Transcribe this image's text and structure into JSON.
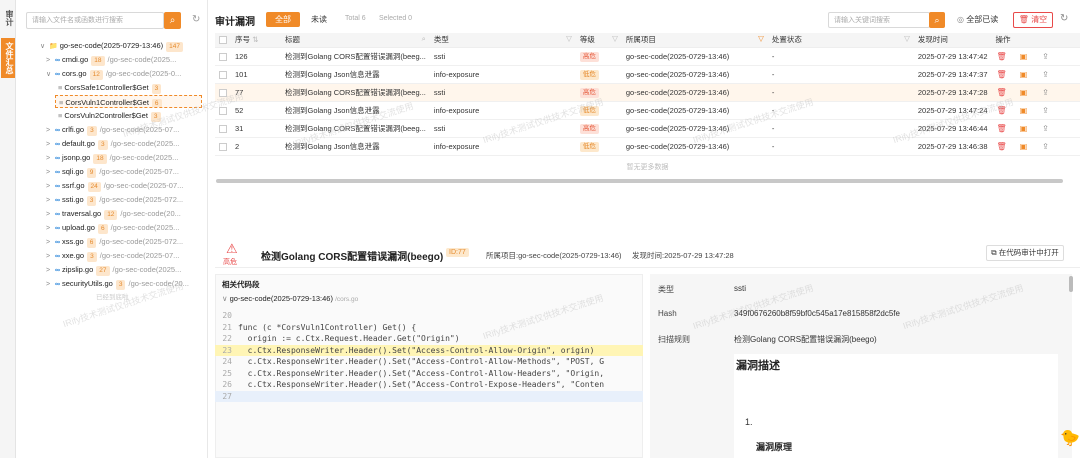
{
  "sidebar_tabs": {
    "tab1": "审计",
    "tab2": "文件汇总"
  },
  "left": {
    "search_placeholder": "请输入文件名或函数进行搜索",
    "tree": [
      {
        "label": "go-sec-code(2025-0729-13:46)",
        "badge": "147",
        "path": ""
      },
      {
        "label": "cmdi.go",
        "badge": "18",
        "path": "/go-sec-code(2025..."
      },
      {
        "label": "cors.go",
        "badge": "12",
        "path": "/go-sec-code(2025-0..."
      },
      {
        "label": "CorsSafe1Controller$Get",
        "badge": "3",
        "path": ""
      },
      {
        "label": "CorsVuln1Controller$Get",
        "badge": "6",
        "path": ""
      },
      {
        "label": "CorsVuln2Controller$Get",
        "badge": "3",
        "path": ""
      },
      {
        "label": "crlfi.go",
        "badge": "3",
        "path": "/go-sec-code(2025-07..."
      },
      {
        "label": "default.go",
        "badge": "3",
        "path": "/go-sec-code(2025..."
      },
      {
        "label": "jsonp.go",
        "badge": "18",
        "path": "/go-sec-code(2025..."
      },
      {
        "label": "sqli.go",
        "badge": "9",
        "path": "/go-sec-code(2025-07..."
      },
      {
        "label": "ssrf.go",
        "badge": "24",
        "path": "/go-sec-code(2025-07..."
      },
      {
        "label": "ssti.go",
        "badge": "3",
        "path": "/go-sec-code(2025-072..."
      },
      {
        "label": "traversal.go",
        "badge": "12",
        "path": "/go-sec-code(20..."
      },
      {
        "label": "upload.go",
        "badge": "6",
        "path": "/go-sec-code(2025..."
      },
      {
        "label": "xss.go",
        "badge": "6",
        "path": "/go-sec-code(2025-072..."
      },
      {
        "label": "xxe.go",
        "badge": "3",
        "path": "/go-sec-code(2025-07..."
      },
      {
        "label": "zipslip.go",
        "badge": "27",
        "path": "/go-sec-code(2025..."
      },
      {
        "label": "securityUtils.go",
        "badge": "3",
        "path": "/go-sec-code(20..."
      }
    ],
    "footer": "已经到底啦"
  },
  "header": {
    "title": "审计漏洞",
    "tab_all": "全部",
    "tab_unread": "未读",
    "total": "Total 6",
    "selected": "Selected 0",
    "search_placeholder": "请输入关键词搜索",
    "read_all": "全部已读",
    "clear": "清空"
  },
  "table": {
    "columns": [
      "序号",
      "标题",
      "类型",
      "等级",
      "所属项目",
      "处置状态",
      "发现时间",
      "操作"
    ],
    "rows": [
      {
        "id": "126",
        "title": "检测到Golang CORS配置错误漏洞(beeg...",
        "type": "ssti",
        "level": "高危",
        "project": "go-sec-code(2025-0729-13:46)",
        "status": "-",
        "time": "2025-07-29 13:47:42"
      },
      {
        "id": "101",
        "title": "检测到Golang Json信息泄露",
        "type": "info-exposure",
        "level": "低危",
        "project": "go-sec-code(2025-0729-13:46)",
        "status": "-",
        "time": "2025-07-29 13:47:37"
      },
      {
        "id": "77",
        "title": "检测到Golang CORS配置错误漏洞(beeg...",
        "type": "ssti",
        "level": "高危",
        "project": "go-sec-code(2025-0729-13:46)",
        "status": "-",
        "time": "2025-07-29 13:47:28"
      },
      {
        "id": "52",
        "title": "检测到Golang Json信息泄露",
        "type": "info-exposure",
        "level": "低危",
        "project": "go-sec-code(2025-0729-13:46)",
        "status": "-",
        "time": "2025-07-29 13:47:24"
      },
      {
        "id": "31",
        "title": "检测到Golang CORS配置错误漏洞(beeg...",
        "type": "ssti",
        "level": "高危",
        "project": "go-sec-code(2025-0729-13:46)",
        "status": "-",
        "time": "2025-07-29 13:46:44"
      },
      {
        "id": "2",
        "title": "检测到Golang Json信息泄露",
        "type": "info-exposure",
        "level": "低危",
        "project": "go-sec-code(2025-0729-13:46)",
        "status": "-",
        "time": "2025-07-29 13:46:38"
      }
    ],
    "no_more": "暂无更多数据"
  },
  "detail": {
    "risk": "高危",
    "title": "检测Golang CORS配置错误漏洞(beego)",
    "id_tag": "ID:77",
    "project": "所属项目:go-sec-code(2025-0729-13:46)",
    "found": "发现时间:2025-07-29 13:47:28",
    "open_btn": "在代码审计中打开",
    "code_header": "相关代码段",
    "code_file": "go-sec-code(2025-0729-13:46)",
    "code_hint": "/cors.go",
    "code": [
      {
        "n": "20",
        "t": ""
      },
      {
        "n": "21",
        "t": "func (c *CorsVuln1Controller) Get() {"
      },
      {
        "n": "22",
        "t": "  origin := c.Ctx.Request.Header.Get(\"Origin\")"
      },
      {
        "n": "23",
        "t": "  c.Ctx.ResponseWriter.Header().Set(\"Access-Control-Allow-Origin\", origin)"
      },
      {
        "n": "24",
        "t": "  c.Ctx.ResponseWriter.Header().Set(\"Access-Control-Allow-Methods\", \"POST, G"
      },
      {
        "n": "25",
        "t": "  c.Ctx.ResponseWriter.Header().Set(\"Access-Control-Allow-Headers\", \"Origin,"
      },
      {
        "n": "26",
        "t": "  c.Ctx.ResponseWriter.Header().Set(\"Access-Control-Expose-Headers\", \"Conten"
      },
      {
        "n": "27",
        "t": ""
      }
    ],
    "info": {
      "type_label": "类型",
      "type_value": "ssti",
      "hash_label": "Hash",
      "hash_value": "349f0676260b8f59bf0c545a17e815858f2dc5fe",
      "rule_label": "扫描规则",
      "rule_value": "检测Golang CORS配置错误漏洞(beego)"
    },
    "desc_title": "漏洞描述",
    "desc_num": "1.",
    "desc_sub": "漏洞原理"
  },
  "watermark": "IRify技术测试仅供技术交流使用",
  "colors": {
    "accent": "#f08a28",
    "danger": "#e84a4a"
  }
}
